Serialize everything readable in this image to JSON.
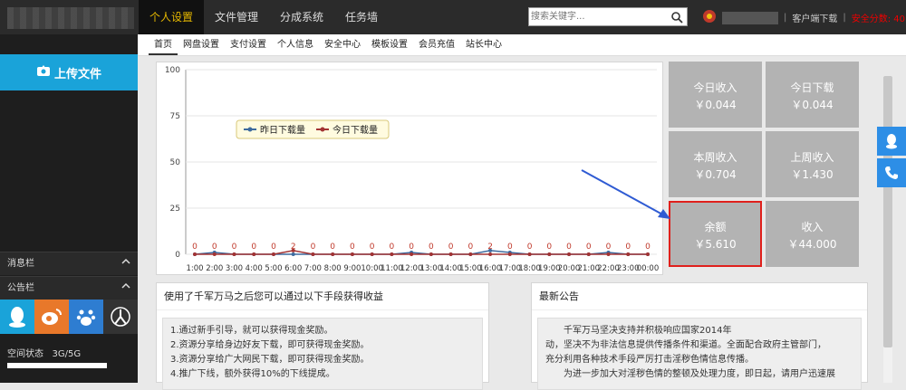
{
  "nav": {
    "items": [
      "个人设置",
      "文件管理",
      "分成系统",
      "任务墙"
    ],
    "active": 0
  },
  "search": {
    "placeholder": "搜索关键字..."
  },
  "user": {
    "client_download": "客户端下载",
    "security_score": "安全分数: 40"
  },
  "sidebar": {
    "upload": "上传文件",
    "messages": "消息栏",
    "notices": "公告栏",
    "space_label": "空间状态",
    "space_value": "3G/5G"
  },
  "subnav": {
    "items": [
      "首页",
      "网盘设置",
      "支付设置",
      "个人信息",
      "安全中心",
      "模板设置",
      "会员充值",
      "站长中心"
    ],
    "active": 0
  },
  "chart_data": {
    "type": "line",
    "x": [
      "1:00",
      "2:00",
      "3:00",
      "4:00",
      "5:00",
      "6:00",
      "7:00",
      "8:00",
      "9:00",
      "10:00",
      "11:00",
      "12:00",
      "13:00",
      "14:00",
      "15:00",
      "16:00",
      "17:00",
      "18:00",
      "19:00",
      "20:00",
      "21:00",
      "22:00",
      "23:00",
      "00:00"
    ],
    "ylim": [
      0,
      100
    ],
    "yticks": [
      0,
      25,
      50,
      75,
      100
    ],
    "legend_position": "top-left",
    "series": [
      {
        "name": "昨日下载量",
        "color": "#3d6a9e",
        "values": [
          0,
          1,
          0,
          0,
          0,
          0,
          0,
          0,
          0,
          0,
          0,
          1,
          0,
          0,
          0,
          2,
          1,
          0,
          0,
          0,
          0,
          1,
          0,
          0
        ]
      },
      {
        "name": "今日下载量",
        "color": "#a33333",
        "values": [
          0,
          0,
          0,
          0,
          0,
          2,
          0,
          0,
          0,
          0,
          0,
          0,
          0,
          0,
          0,
          0,
          0,
          0,
          0,
          0,
          0,
          0,
          0,
          0
        ]
      }
    ],
    "point_labels": [
      "0",
      "0",
      "0",
      "0",
      "0",
      "2",
      "0",
      "0",
      "0",
      "0",
      "0",
      "0",
      "0",
      "0",
      "0",
      "2",
      "0",
      "0",
      "0",
      "0",
      "0",
      "0",
      "0",
      "0"
    ]
  },
  "stats": [
    {
      "label": "今日收入",
      "value": "￥0.044"
    },
    {
      "label": "今日下载",
      "value": "￥0.044"
    },
    {
      "label": "本周收入",
      "value": "￥0.704"
    },
    {
      "label": "上周收入",
      "value": "￥1.430"
    },
    {
      "label": "余额",
      "value": "￥5.610"
    },
    {
      "label": "收入",
      "value": "￥44.000"
    }
  ],
  "tips": {
    "title": "使用了千军万马之后您可以通过以下手段获得收益",
    "lines": [
      "1.通过新手引导，就可以获得现金奖励。",
      "2.资源分享给身边好友下载，即可获得现金奖励。",
      "3.资源分享给广大网民下载，即可获得现金奖励。",
      "4.推广下线，额外获得10%的下线提成。"
    ]
  },
  "announcement": {
    "title": "最新公告",
    "lines": [
      "千军万马坚决支持并积极响应国家2014年",
      "动，坚决不为非法信息提供传播条件和渠道。全面配合政府主管部门，",
      "充分利用各种技术手段严厉打击淫秽色情信息传播。",
      "为进一步加大对淫秽色情的整顿及处理力度，即日起，请用户迅速展"
    ]
  },
  "colors": {
    "accent": "#1aa3d9",
    "highlight": "#e0201c",
    "tile": "#b3b3b3",
    "topbar": "#2b2b2b"
  }
}
